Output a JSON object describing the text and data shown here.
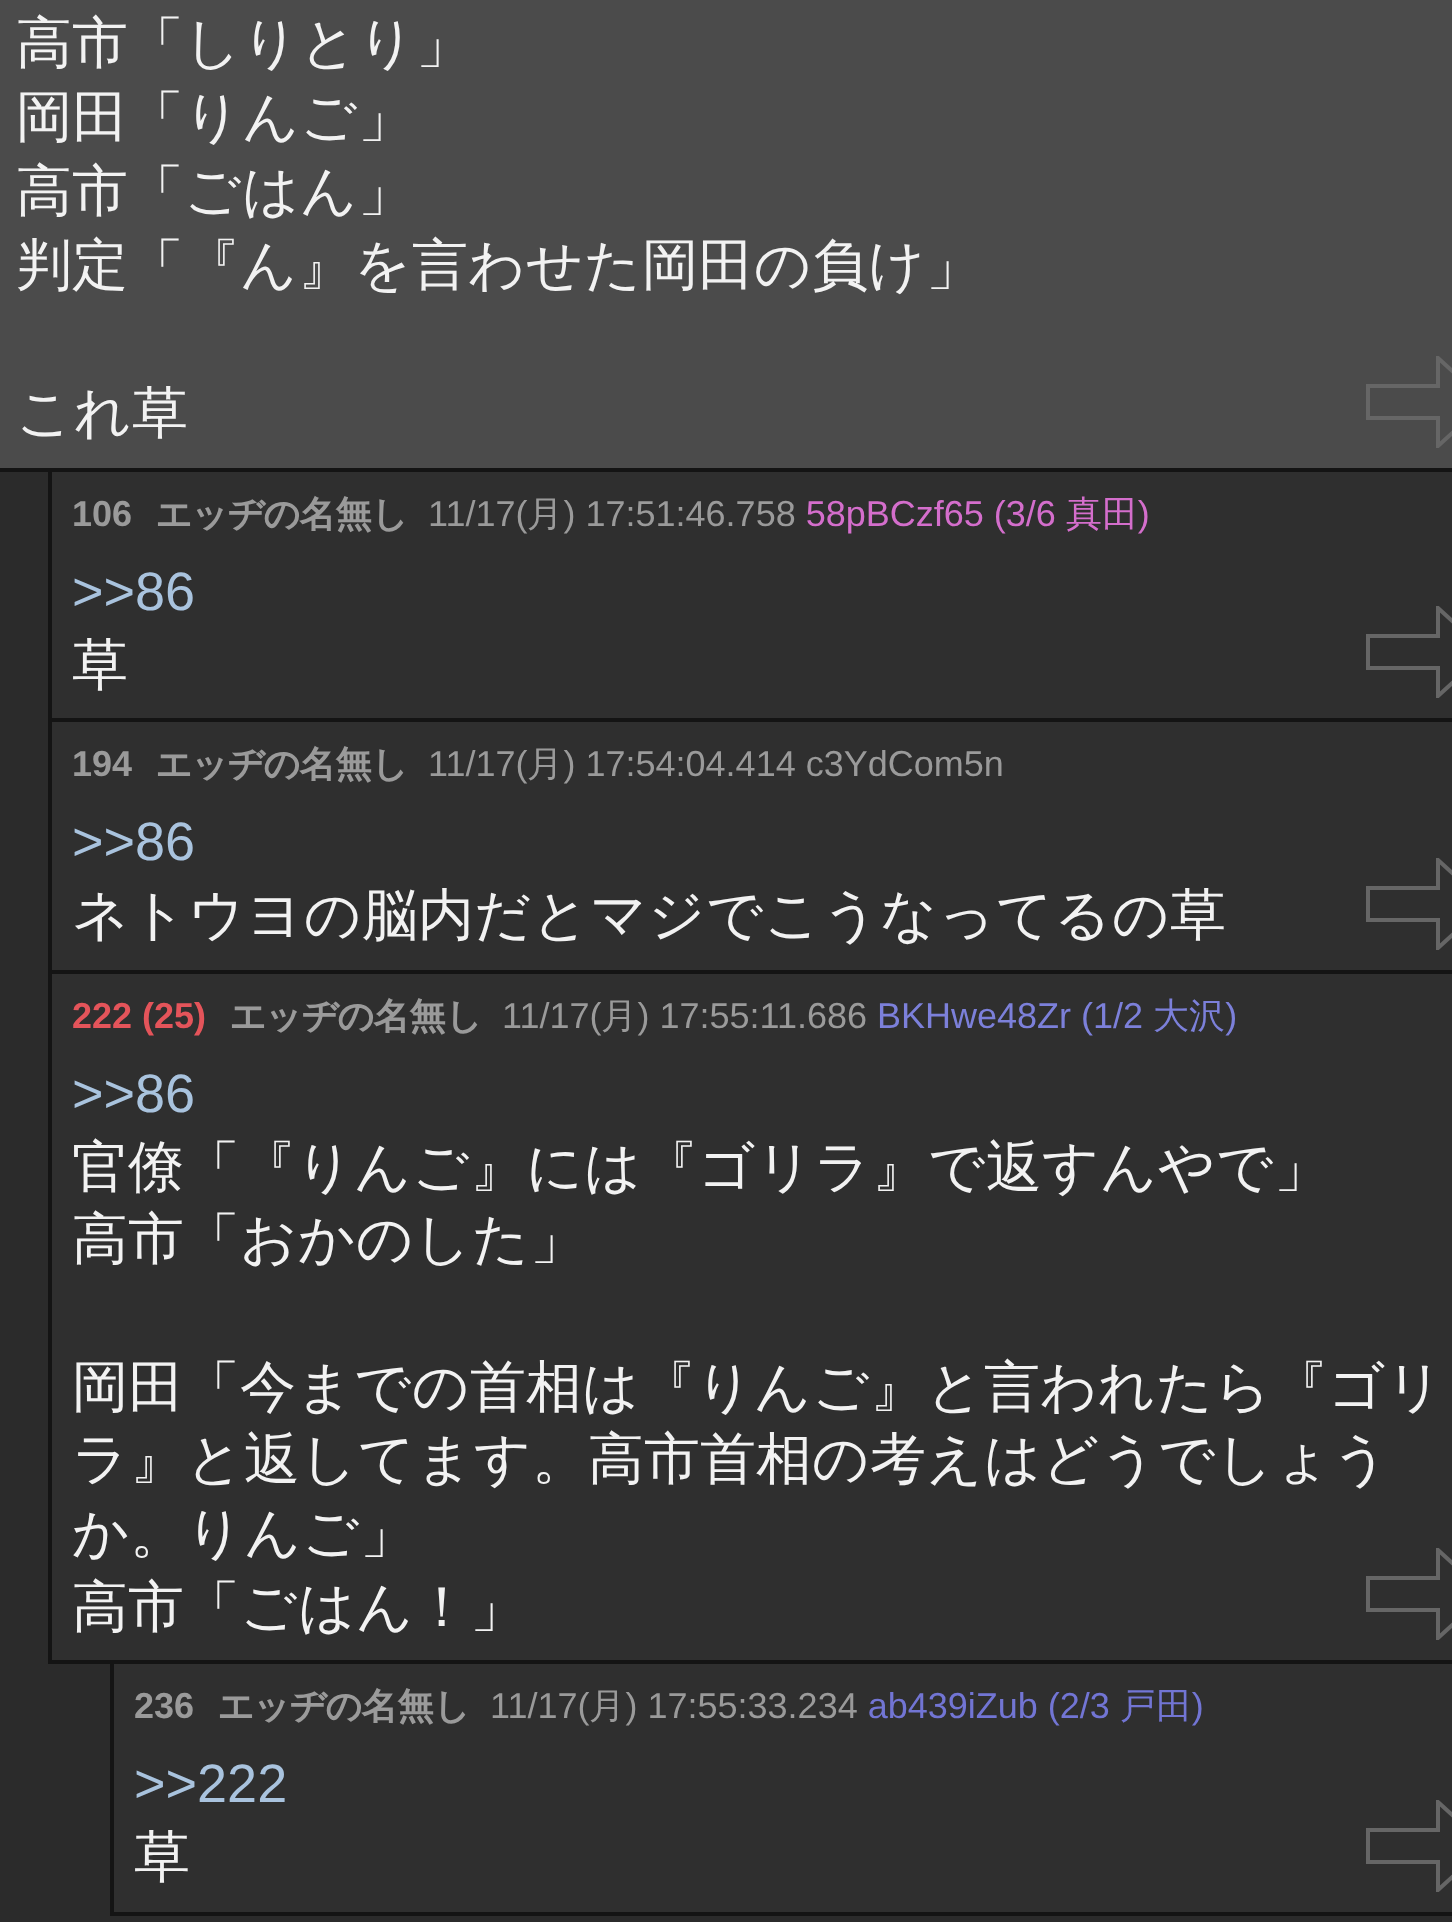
{
  "post": {
    "paragraphs": [
      {
        "lines": [
          "高市「しりとり」",
          "岡田「りんご」",
          "高市「ごはん」",
          "判定「『ん』を言わせた岡田の負け」"
        ]
      },
      {
        "lines": [
          "これ草"
        ]
      }
    ],
    "children": [
      {
        "number": {
          "text": "106",
          "color": "#9a9a9a"
        },
        "name": "エッヂの名無し",
        "date": "11/17(月) 17:51:46.758",
        "id": {
          "text": "58pBCzf65 (3/6 真田)",
          "color": "#d46ecc"
        },
        "anchor": ">>86",
        "paragraphs": [
          {
            "lines": [
              "草"
            ]
          }
        ]
      },
      {
        "number": {
          "text": "194",
          "color": "#9a9a9a"
        },
        "name": "エッヂの名無し",
        "date": "11/17(月) 17:54:04.414",
        "id": {
          "text": "c3YdCom5n",
          "color": "#9a9a9a"
        },
        "anchor": ">>86",
        "paragraphs": [
          {
            "lines": [
              "ネトウヨの脳内だとマジでこうなってるの草"
            ]
          }
        ]
      },
      {
        "number": {
          "text": "222 (25)",
          "color": "#e4545a"
        },
        "name": "エッヂの名無し",
        "date": "11/17(月) 17:55:11.686",
        "id": {
          "text": "BKHwe48Zr (1/2 大沢)",
          "color": "#7c80da"
        },
        "anchor": ">>86",
        "paragraphs": [
          {
            "lines": [
              "官僚「『りんご』には『ゴリラ』で返すんやで」",
              "高市「おかのした」"
            ]
          },
          {
            "lines": [
              "岡田「今までの首相は『りんご』と言われたら『ゴリラ』と返してます。高市首相の考えはどうでしょうか。りんご」",
              "高市「ごはん！」"
            ]
          }
        ],
        "children": [
          {
            "number": {
              "text": "236",
              "color": "#9a9a9a"
            },
            "name": "エッヂの名無し",
            "date": "11/17(月) 17:55:33.234",
            "id": {
              "text": "ab439iZub (2/3 戸田)",
              "color": "#7275d4"
            },
            "anchor": ">>222",
            "paragraphs": [
              {
                "lines": [
                  "草"
                ]
              }
            ]
          }
        ]
      }
    ]
  }
}
